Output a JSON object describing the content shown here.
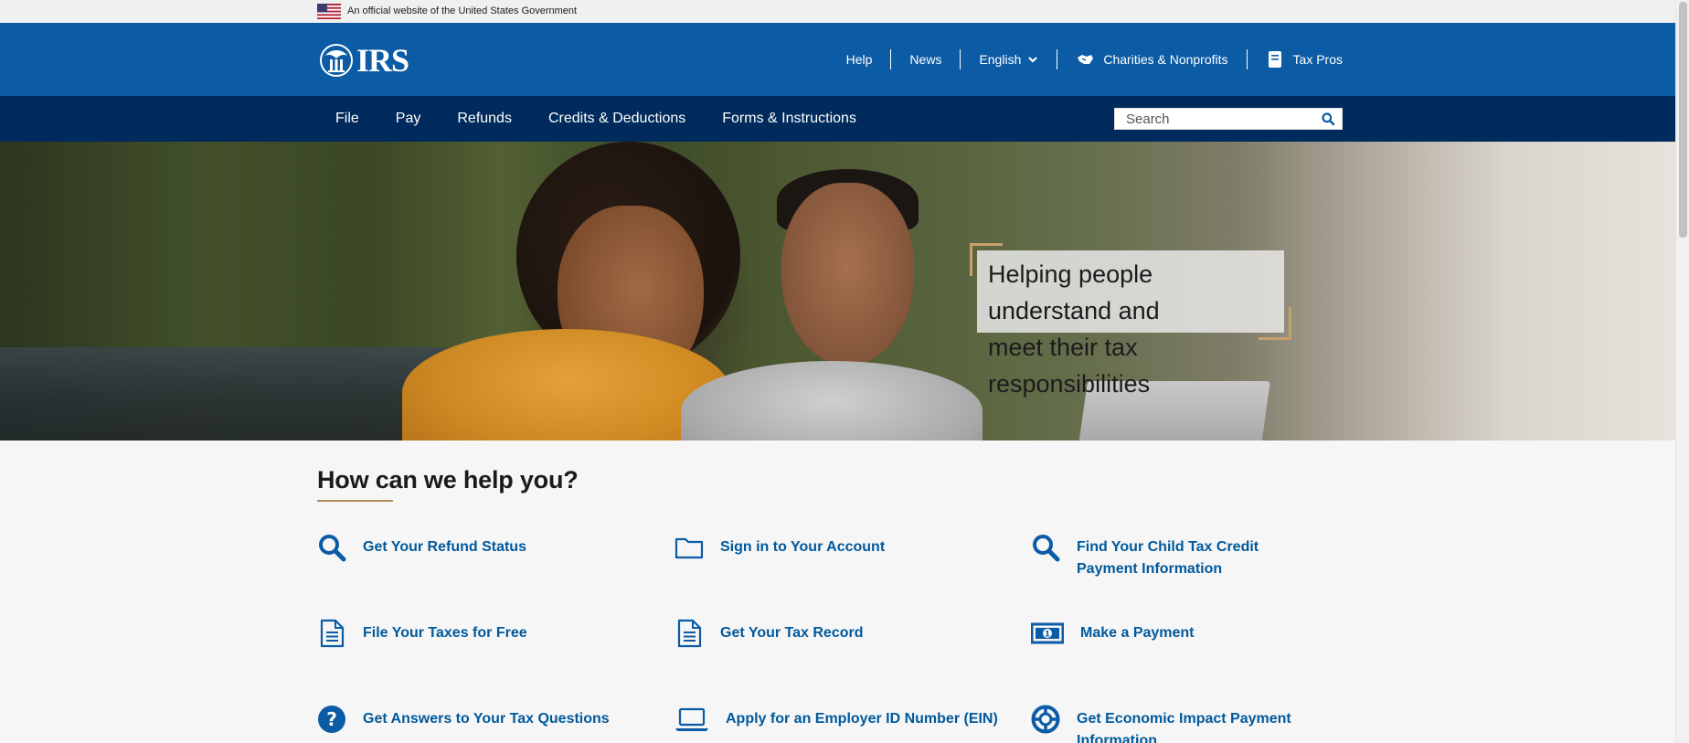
{
  "gov_banner": {
    "text": "An official website of the United States Government"
  },
  "header": {
    "logo_text": "IRS",
    "utility_nav": [
      {
        "label": "Help"
      },
      {
        "label": "News"
      },
      {
        "label": "English"
      },
      {
        "label": "Charities & Nonprofits",
        "icon": "handshake-icon"
      },
      {
        "label": "Tax Pros",
        "icon": "book-icon"
      }
    ]
  },
  "main_nav": {
    "links": [
      {
        "label": "File"
      },
      {
        "label": "Pay"
      },
      {
        "label": "Refunds"
      },
      {
        "label": "Credits & Deductions"
      },
      {
        "label": "Forms & Instructions"
      }
    ],
    "search": {
      "placeholder": "Search",
      "value": ""
    }
  },
  "hero": {
    "tagline_line1": "Helping people understand and",
    "tagline_line2": "meet their tax responsibilities"
  },
  "help_section": {
    "heading": "How can we help you?",
    "tiles": [
      {
        "label": "Get Your Refund Status",
        "icon": "search-icon"
      },
      {
        "label": "Sign in to Your Account",
        "icon": "folder-icon"
      },
      {
        "label": "Find Your Child Tax Credit Payment Information",
        "icon": "search-icon"
      },
      {
        "label": "File Your Taxes for Free",
        "icon": "document-icon"
      },
      {
        "label": "Get Your Tax Record",
        "icon": "document-icon"
      },
      {
        "label": "Make a Payment",
        "icon": "money-icon"
      },
      {
        "label": "Get Answers to Your Tax Questions",
        "icon": "question-icon"
      },
      {
        "label": "Apply for an Employer ID Number (EIN)",
        "icon": "laptop-icon"
      },
      {
        "label": "Get Economic Impact Payment Information",
        "icon": "lifebuoy-icon"
      }
    ]
  },
  "colors": {
    "header_blue": "#0b5ba5",
    "nav_navy": "#002b5c",
    "link_blue": "#00599c",
    "accent_gold": "#b08d57"
  }
}
